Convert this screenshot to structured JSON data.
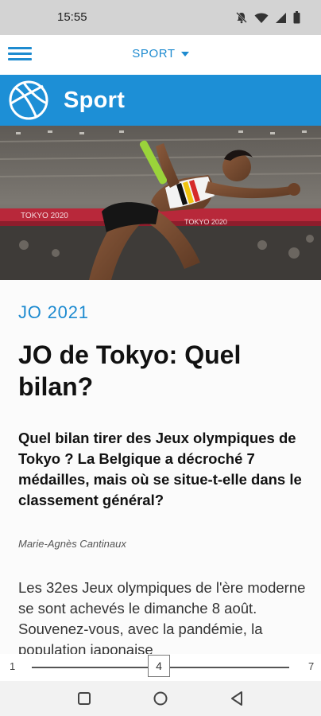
{
  "status_bar": {
    "time": "15:55"
  },
  "header": {
    "section_label": "SPORT"
  },
  "banner": {
    "title": "Sport"
  },
  "hero_image": {
    "alt_icon": "athlete-relay-photo"
  },
  "article": {
    "category": "JO 2021",
    "headline": "JO de Tokyo: Quel bilan?",
    "lead": "Quel bilan tirer des Jeux olympiques de Tokyo ? La Belgique a décroché 7 médailles, mais où se situe-t-elle dans le classement général?",
    "author": "Marie-Agnès Cantinaux",
    "body": "Les 32es Jeux olympiques de l'ère moderne se sont achevés le dimanche 8 août. Souvenez-vous, avec la pandémie, la population japonaise"
  },
  "pager": {
    "start": "1",
    "current": "4",
    "end": "7",
    "fraction": 0.5
  },
  "colors": {
    "accent": "#1e8bd0",
    "banner": "#1d8fd6"
  }
}
